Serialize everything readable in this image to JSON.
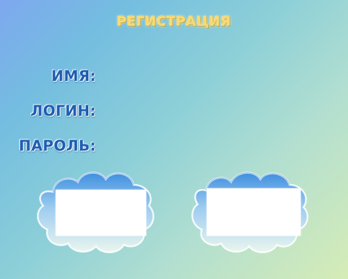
{
  "header": {
    "title": "РЕГИСТРАЦИЯ"
  },
  "form": {
    "name_label": "ИМЯ:",
    "login_label": "ЛОГИН:",
    "password_label": "ПАРОЛЬ:"
  },
  "buttons": {
    "left": {
      "label": "",
      "icon": "cloud-icon"
    },
    "right": {
      "label": "",
      "icon": "cloud-icon"
    }
  },
  "colors": {
    "title": "#f3dc7a",
    "labels": "#1f5fb2",
    "cloud_top": "#3f8fe0",
    "cloud_bottom": "#eaf6ee"
  }
}
